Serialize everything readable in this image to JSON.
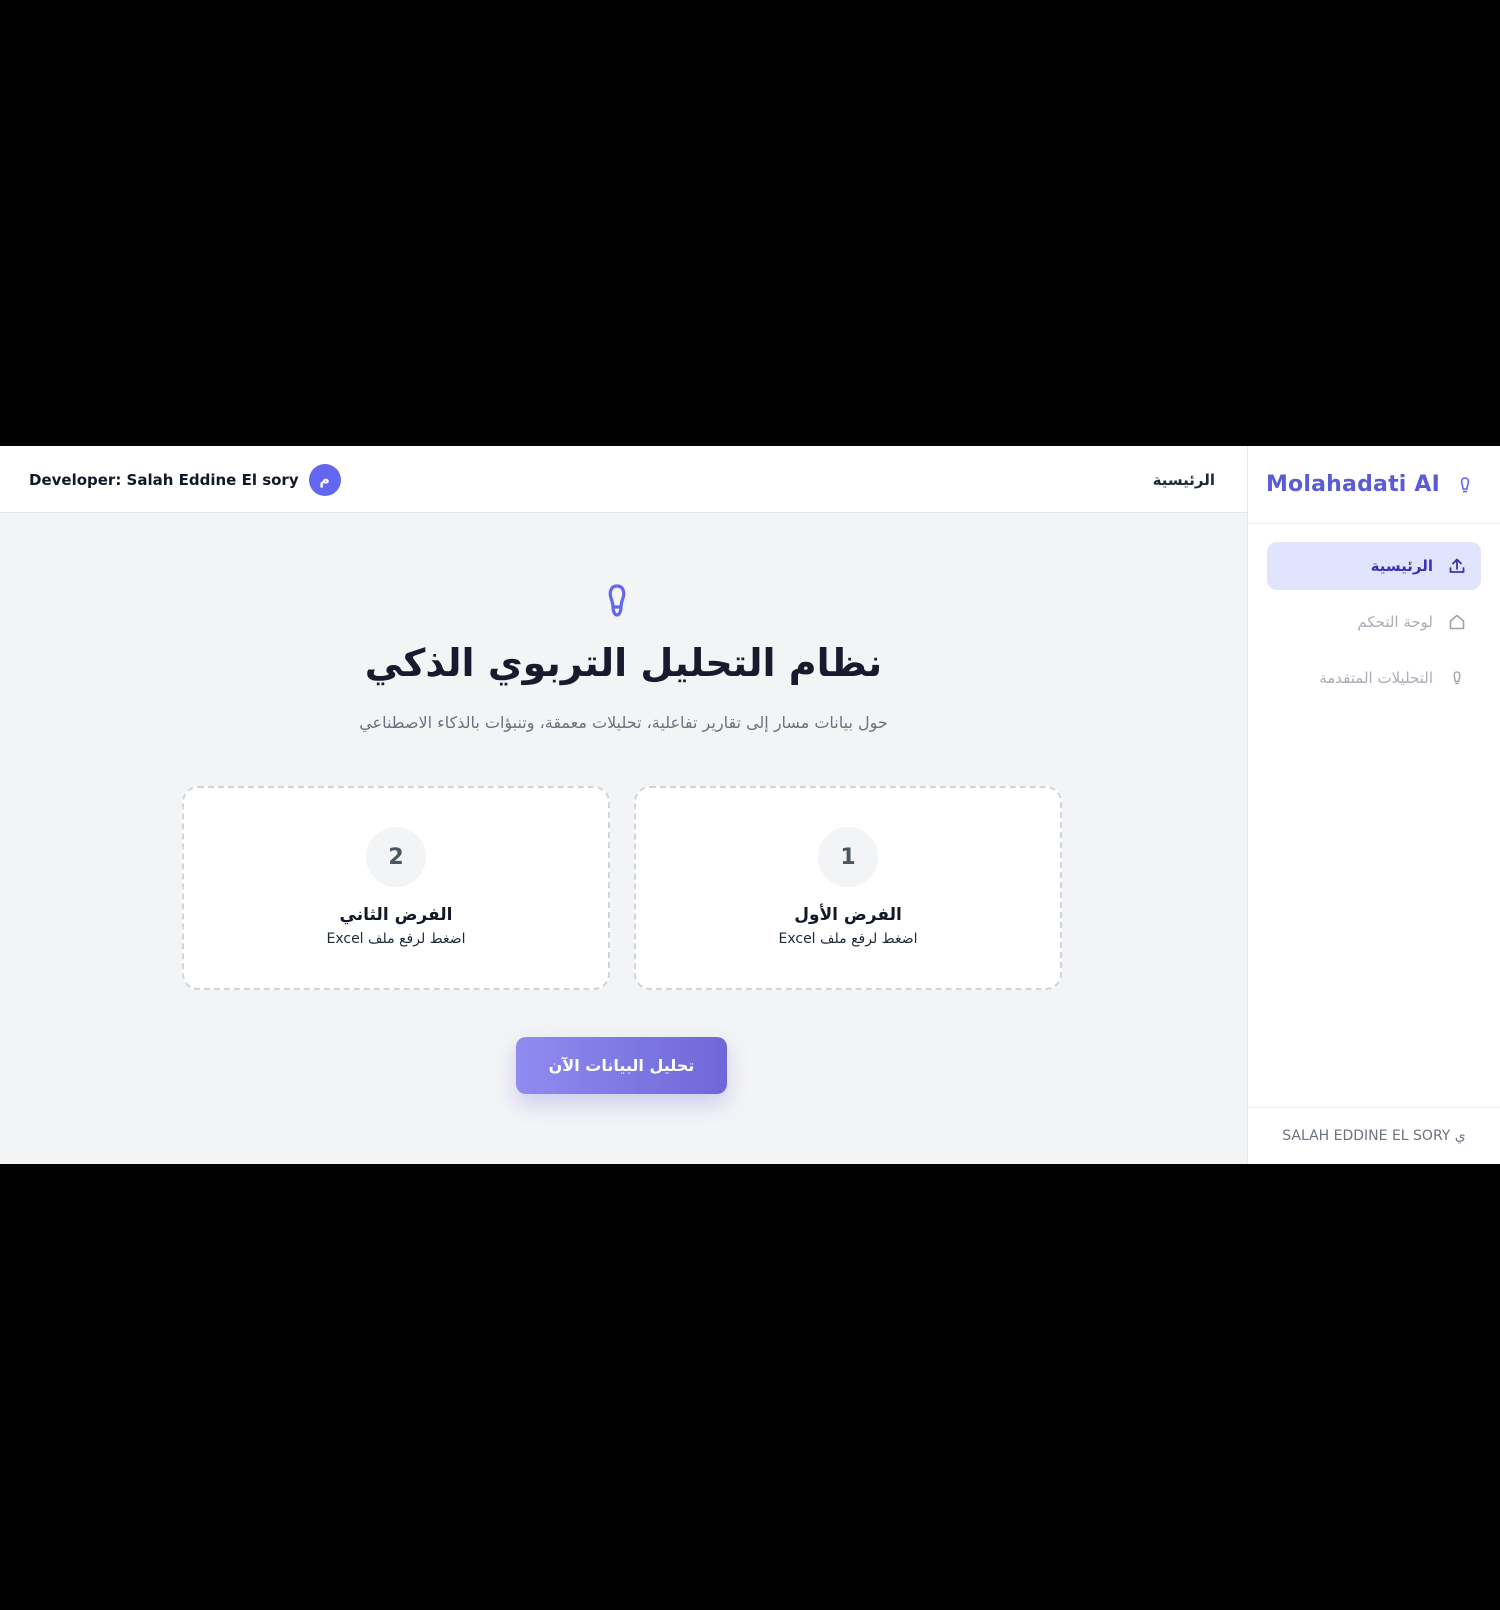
{
  "brand": {
    "name": "Molahadati AI",
    "icon": "bulb-outline-icon",
    "accent_color": "#5b5bd6"
  },
  "sidebar": {
    "items": [
      {
        "label": "الرئيسية",
        "icon": "upload-icon",
        "active": true
      },
      {
        "label": "لوحة التحكم",
        "icon": "home-icon",
        "active": false
      },
      {
        "label": "التحليلات المتقدمة",
        "icon": "bulb-outline-icon",
        "active": false
      }
    ],
    "footer": "SALAH EDDINE EL SORY ي"
  },
  "header": {
    "title": "الرئيسية",
    "developer": "Developer: Salah Eddine El sory",
    "avatar_initial": "م",
    "avatar_color": "#6366f1"
  },
  "hero": {
    "icon": "bulb-outline-icon",
    "title": "نظام التحليل التربوي الذكي",
    "subtitle": "حول بيانات مسار إلى تقارير تفاعلية، تحليلات معمقة، وتنبؤات بالذكاء الاصطناعي"
  },
  "uploads": [
    {
      "number": "1",
      "title": "الفرض الأول",
      "hint": "اضغط لرفع ملف Excel"
    },
    {
      "number": "2",
      "title": "الفرض الثاني",
      "hint": "اضغط لرفع ملف Excel"
    }
  ],
  "action": {
    "label": "تحليل البيانات الآن"
  }
}
